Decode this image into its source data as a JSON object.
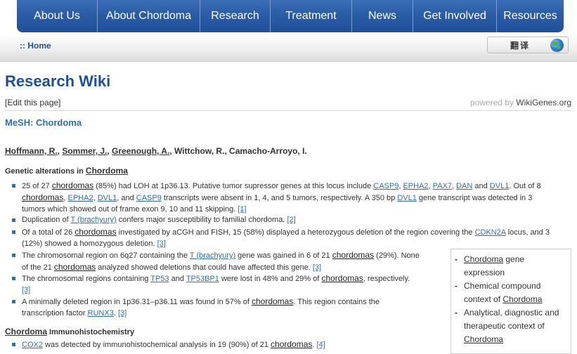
{
  "nav": {
    "items": [
      {
        "label": "About Us"
      },
      {
        "label": "About Chordoma"
      },
      {
        "label": "Research"
      },
      {
        "label": "Treatment"
      },
      {
        "label": "News"
      },
      {
        "label": "Get Involved"
      },
      {
        "label": "Resources"
      }
    ]
  },
  "breadcrumb": {
    "home": ":: Home"
  },
  "translate": {
    "label": "翻译",
    "icon": "globe-icon"
  },
  "page": {
    "title": "Research Wiki",
    "edit_link": "[Edit this page]",
    "powered_prefix": "powered by",
    "powered_name": "WikiGenes.org",
    "mesh_title": "MeSH: Chordoma"
  },
  "authors": {
    "a1": "Hoffmann, R.",
    "sep1": ", ",
    "a2": "Sommer, J.",
    "sep2": ", ",
    "a3": "Greenough, A.",
    "rest": ", Wittchow, R., Camacho-Arroyo, I."
  },
  "genetic": {
    "heading_prefix": "Genetic alterations in ",
    "heading_term": "Chordoma",
    "b1": {
      "t1": "25 of 27 ",
      "term1": "chordomas",
      "t2": " (85%) had LOH at 1p36.13. Putative tumor supressor genes at this locus include ",
      "g1": "CASP9",
      "c1": ", ",
      "g2": "EPHA2",
      "c2": ", ",
      "g3": "PAX7",
      "c3": ", ",
      "g4": "DAN",
      "and1": " and ",
      "g5": "DVL1",
      "t3": ". Out of 8",
      "term2": "chordomas",
      "c4": ", ",
      "g6": "EPHA2",
      "c5": ", ",
      "g7": "DVL1",
      "and2": ", and ",
      "g8": "CASP9",
      "t4": " transcripts were absent in 1, 4, and 5 tumors, respectively. A 350 bp ",
      "g9": "DVL1",
      "t5": " gene transcript was detected in 3",
      "line3": "tumors which showed out of frame exon 9, 10 and 11 skipping. ",
      "ref": "[1]"
    },
    "b2": {
      "t1": "Duplication of ",
      "g1": "T (brachyury)",
      "t2": " confers major susceptibility to familial chordoma. ",
      "ref": "[2]"
    },
    "b3": {
      "t1": "Of a total of 26 ",
      "term1": "chordomas",
      "t2": " investigated by aCGH and FISH, 15 (58%) displayed a heterozygous deletion of the region covering the ",
      "g1": "CDKN2A",
      "t3": " locus, and 3",
      "line2": "(12%) showed a homozygous deletion. ",
      "ref": "[3]"
    },
    "b4": {
      "t1": "The chromosomal region on 6q27 containing the ",
      "g1": "T (brachyury)",
      "t2": " gene was gained in 6 of 21 ",
      "term1": "chordomas",
      "t3": " (29%). None",
      "l2a": "of the 21 ",
      "term2": "chordomas",
      "l2b": " analyzed showed deletions that could have affected this gene. ",
      "ref": "[3]"
    },
    "b5": {
      "t1": "The chromosomal regions containing ",
      "g1": "TP53",
      "and1": " and ",
      "g2": "TP53BP1",
      "t2": " were lost in 48% and 29% of ",
      "term1": "chordomas",
      "t3": ", respectively.",
      "ref": "[3]"
    },
    "b6": {
      "t1": "A minimally deleted region in 1p36.31–p36.11 was found in 57% of ",
      "term1": "chordomas",
      "t2": ". This region contains the",
      "l2": "transcription factor ",
      "g1": "RUNX3",
      "dot": ". ",
      "ref": "[3]"
    }
  },
  "ihc": {
    "heading_term": "Chordoma",
    "heading_rest": " Immunohistochemistry",
    "b1": {
      "g1": "COX2",
      "t1": " was detected by immunohistochemical analysis in 19 (90%) of 21 ",
      "term1": "chordomas",
      "dot": ". ",
      "ref": "[4]"
    }
  },
  "sidebar": {
    "items": [
      {
        "dash": "-",
        "term": "Chordoma",
        "rest": " gene",
        "line2": "expression"
      },
      {
        "dash": "-",
        "line1": "Chemical compound",
        "l2a": "context of ",
        "term": "Chordoma"
      },
      {
        "dash": "-",
        "line1": "Analytical, diagnostic and",
        "line2": "therapeutic context of",
        "term": "Chordoma"
      }
    ]
  }
}
